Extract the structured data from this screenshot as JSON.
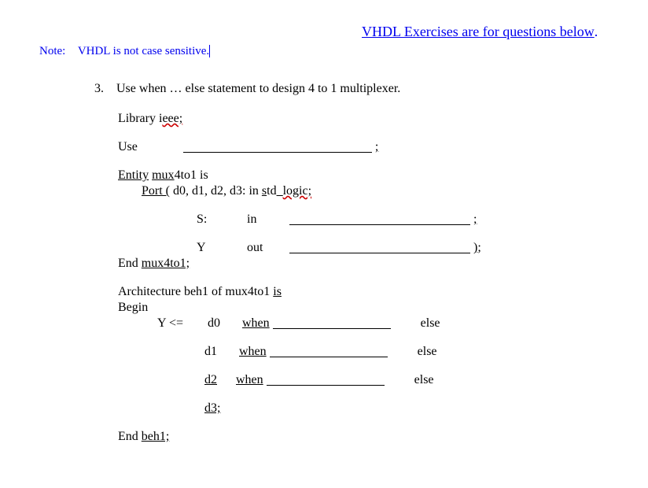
{
  "title": "VHDL Exercises are for questions below",
  "title_period": ".",
  "note": {
    "label": "Note:",
    "text": "VHDL is not case sensitive"
  },
  "question": {
    "number": "3.",
    "prompt": "Use when … else statement to design 4 to 1 multiplexer.",
    "code": {
      "library": {
        "kw": "Library",
        "lib": "ieee;",
        "lib_plain_i": "i",
        "lib_wavy": "eee;"
      },
      "use": {
        "kw": "Use",
        "tail_semi": ";"
      },
      "entity": {
        "kw": "Entity",
        "name_ul": "mux",
        "name_rest": "4to1  is",
        "port_kw": "Port  (",
        "port_sigs": " d0, d1, d2, d3:   in ",
        "port_std_s": "s",
        "port_std_td": "td",
        "port_std_logic": "logic;",
        "s_line": {
          "name": "S:",
          "dir": "in",
          "tail": ";"
        },
        "y_line": {
          "name": "Y",
          "dir": "out",
          "tail": ");"
        }
      },
      "end_entity": {
        "text": "End ",
        "name": "mux4to1;"
      },
      "arch": {
        "header_pre": "Architecture beh1 of mux4to1 ",
        "header_is": "is",
        "begin": "Begin",
        "assign": {
          "lhs": "Y <=",
          "rows": [
            {
              "sig": "d0",
              "when": "when",
              "else": "else"
            },
            {
              "sig": "d1",
              "when": "when",
              "else": "else"
            },
            {
              "sig": "d2",
              "when": "when",
              "else": "else"
            },
            {
              "sig": "d3;",
              "when": "",
              "else": ""
            }
          ]
        }
      },
      "end_arch": {
        "text": "End ",
        "name": "beh1;"
      }
    }
  }
}
